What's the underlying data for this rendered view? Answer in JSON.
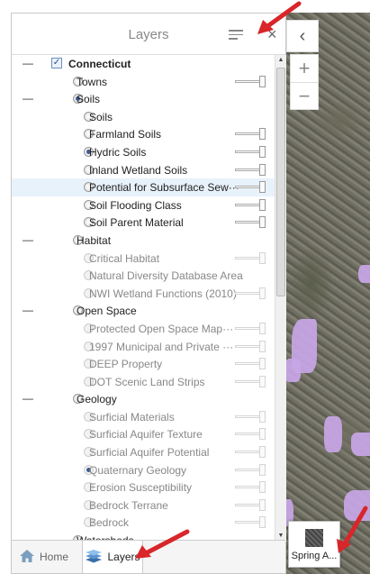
{
  "panel": {
    "title": "Layers"
  },
  "bottom_tabs": {
    "home": "Home",
    "layers": "Layers"
  },
  "basemap_label": "Spring A...",
  "layers": [
    {
      "label": "Connecticut",
      "type": "check",
      "level": 0,
      "expander": "—",
      "checked": true,
      "dim": false
    },
    {
      "label": "Towns",
      "type": "radio",
      "level": 1,
      "selected": false,
      "slider": true,
      "dim": false
    },
    {
      "label": "Soils",
      "type": "radio",
      "level": 1,
      "expander": "—",
      "selected": true,
      "dim": false
    },
    {
      "label": "Soils",
      "type": "radio",
      "level": 2,
      "selected": false,
      "dim": false
    },
    {
      "label": "Farmland Soils",
      "type": "radio",
      "level": 2,
      "selected": false,
      "slider": true,
      "dim": false
    },
    {
      "label": "Hydric Soils",
      "type": "radio",
      "level": 2,
      "selected": true,
      "slider": true,
      "dim": false
    },
    {
      "label": "Inland Wetland Soils",
      "type": "radio",
      "level": 2,
      "selected": false,
      "slider": true,
      "dim": false
    },
    {
      "label": "Potential for Subsurface Sew···",
      "type": "radio",
      "level": 2,
      "selected": false,
      "slider": true,
      "dim": false,
      "highlight": true
    },
    {
      "label": "Soil Flooding Class",
      "type": "radio",
      "level": 2,
      "selected": false,
      "slider": true,
      "dim": false
    },
    {
      "label": "Soil Parent Material",
      "type": "radio",
      "level": 2,
      "selected": false,
      "slider": true,
      "dim": false
    },
    {
      "label": "Habitat",
      "type": "radio",
      "level": 1,
      "expander": "—",
      "selected": false,
      "dim": false
    },
    {
      "label": "Critical Habitat",
      "type": "radio",
      "level": 2,
      "selected": false,
      "slider": true,
      "dim": true
    },
    {
      "label": "Natural Diversity Database Area",
      "type": "radio",
      "level": 2,
      "selected": false,
      "dim": true
    },
    {
      "label": "NWI Wetland Functions (2010)",
      "type": "radio",
      "level": 2,
      "selected": false,
      "slider": true,
      "dim": true
    },
    {
      "label": "Open Space",
      "type": "radio",
      "level": 1,
      "expander": "—",
      "selected": false,
      "dim": false
    },
    {
      "label": "Protected Open Space Map···",
      "type": "radio",
      "level": 2,
      "selected": false,
      "slider": true,
      "dim": true
    },
    {
      "label": "1997 Municipal and Private ···",
      "type": "radio",
      "level": 2,
      "selected": false,
      "slider": true,
      "dim": true
    },
    {
      "label": "DEEP Property",
      "type": "radio",
      "level": 2,
      "selected": false,
      "slider": true,
      "dim": true
    },
    {
      "label": "DOT Scenic Land Strips",
      "type": "radio",
      "level": 2,
      "selected": false,
      "slider": true,
      "dim": true
    },
    {
      "label": "Geology",
      "type": "radio",
      "level": 1,
      "expander": "—",
      "selected": false,
      "dim": false
    },
    {
      "label": "Surficial Materials",
      "type": "radio",
      "level": 2,
      "selected": false,
      "slider": true,
      "dim": true
    },
    {
      "label": "Surficial Aquifer Texture",
      "type": "radio",
      "level": 2,
      "selected": false,
      "slider": true,
      "dim": true
    },
    {
      "label": "Surficial Aquifer Potential",
      "type": "radio",
      "level": 2,
      "selected": false,
      "slider": true,
      "dim": true
    },
    {
      "label": "Quaternary Geology",
      "type": "radio",
      "level": 2,
      "selected": true,
      "slider": true,
      "dim": true
    },
    {
      "label": "Erosion Susceptibility",
      "type": "radio",
      "level": 2,
      "selected": false,
      "slider": true,
      "dim": true
    },
    {
      "label": "Bedrock Terrane",
      "type": "radio",
      "level": 2,
      "selected": false,
      "slider": true,
      "dim": true
    },
    {
      "label": "Bedrock",
      "type": "radio",
      "level": 2,
      "selected": false,
      "slider": true,
      "dim": true
    },
    {
      "label": "Watersheds",
      "type": "radio",
      "level": 1,
      "selected": false,
      "dim": false
    }
  ],
  "colors": {
    "arrow": "#d8262a",
    "purple_overlay": "#c8a6e6",
    "highlight": "#e8f2fb"
  }
}
